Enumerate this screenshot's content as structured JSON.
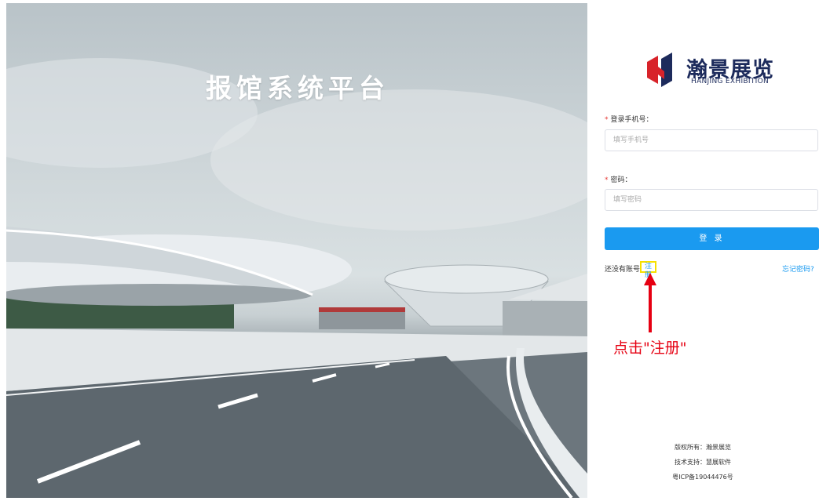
{
  "hero": {
    "title": "报馆系统平台"
  },
  "brand": {
    "name_cn": "瀚景展览",
    "name_en": "HANJING EXHIBITION"
  },
  "form": {
    "phone_label": "登录手机号：",
    "phone_placeholder": "填写手机号",
    "password_label": "密码：",
    "password_placeholder": "填写密码",
    "required_mark": "*",
    "login_button": "登 录",
    "no_account_text": "还没有账号",
    "register_link": "注册",
    "forgot_link": "忘记密码?"
  },
  "annotation": {
    "text": "点击\"注册\""
  },
  "footer": {
    "copyright": "版权所有：瀚景展览",
    "support": "技术支持：慧展软件",
    "icp": "粤ICP备19044476号"
  },
  "colors": {
    "primary": "#1a9af0",
    "brand_navy": "#1d2b5c",
    "brand_red": "#d8232a",
    "annotation_red": "#e60012",
    "highlight": "#f7e000"
  },
  "icons": [
    "hanjing-logo-icon",
    "red-arrow-icon"
  ]
}
